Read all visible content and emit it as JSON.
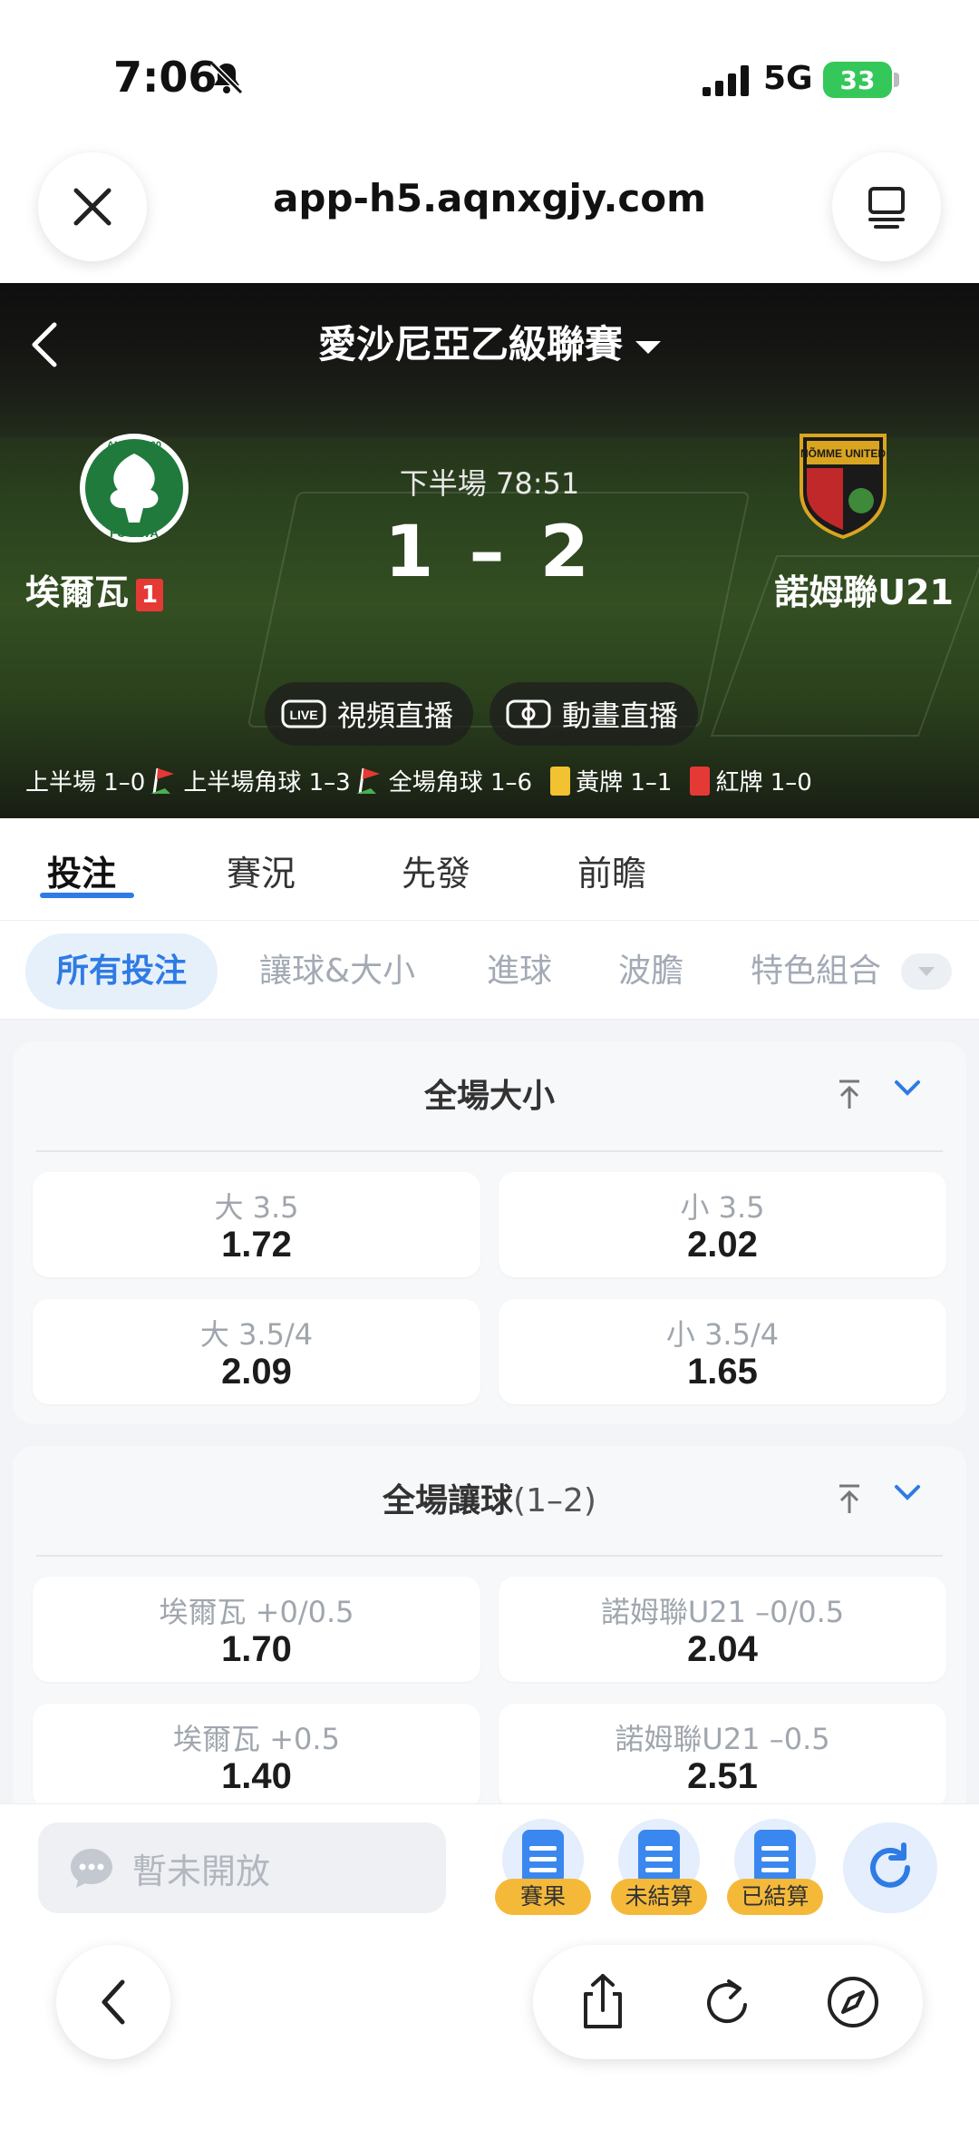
{
  "status_bar": {
    "time": "7:06",
    "network": "5G",
    "battery": "33"
  },
  "browser": {
    "url": "app-h5.aqnxgjy.com"
  },
  "match": {
    "league": "愛沙尼亞乙級聯賽",
    "period": "下半場 78:51",
    "score": "1 – 2",
    "home": {
      "name": "埃爾瓦",
      "red_cards": "1",
      "crest_text": "FC ELVA",
      "crest_top": "ANNO 2000"
    },
    "away": {
      "name": "諾姆聯U21",
      "crest_text": "NÕMME UNITED"
    },
    "video_live_label": "視頻直播",
    "anim_live_label": "動畫直播",
    "live_badge": "LIVE",
    "stats": {
      "first_half": "上半場 1–0",
      "first_half_corners": "上半場角球 1–3",
      "full_corners": "全場角球 1–6",
      "yellow": "黃牌 1–1",
      "red": "紅牌 1–0"
    }
  },
  "tabs": [
    {
      "label": "投注",
      "active": true
    },
    {
      "label": "賽況"
    },
    {
      "label": "先發"
    },
    {
      "label": "前瞻"
    }
  ],
  "filters": [
    "所有投注",
    "讓球&大小",
    "進球",
    "波膽",
    "特色組合"
  ],
  "markets": [
    {
      "title": "全場大小",
      "subtitle": "",
      "odds": [
        {
          "label": "大 3.5",
          "value": "1.72"
        },
        {
          "label": "小 3.5",
          "value": "2.02"
        },
        {
          "label": "大 3.5/4",
          "value": "2.09"
        },
        {
          "label": "小 3.5/4",
          "value": "1.65"
        }
      ]
    },
    {
      "title": "全場讓球",
      "subtitle": "(1–2)",
      "odds": [
        {
          "label": "埃爾瓦 +0/0.5",
          "value": "1.70"
        },
        {
          "label": "諾姆聯U21 –0/0.5",
          "value": "2.04"
        },
        {
          "label": "埃爾瓦 +0.5",
          "value": "1.40"
        },
        {
          "label": "諾姆聯U21 –0.5",
          "value": "2.51"
        }
      ]
    }
  ],
  "action_bar": {
    "chat_placeholder": "暫未開放",
    "results_label": "賽果",
    "unsettled_label": "未結算",
    "settled_label": "已結算"
  },
  "colors": {
    "accent": "#2f7be5",
    "tag": "#f5b93a",
    "red_card": "#e53935",
    "yellow_card": "#f2c230"
  }
}
